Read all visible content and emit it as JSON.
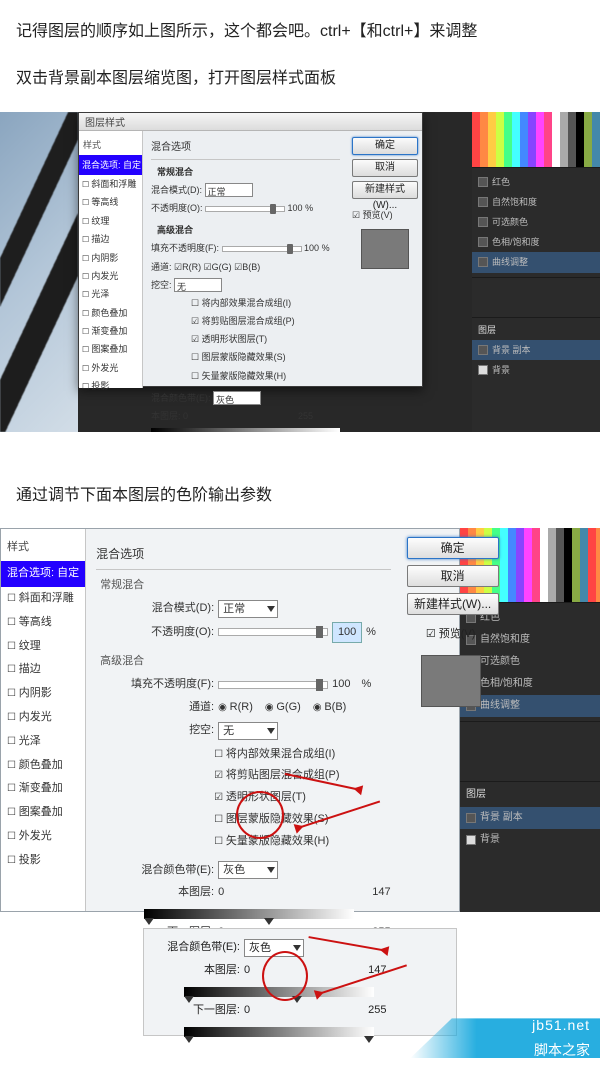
{
  "article": {
    "p1": "记得图层的顺序如上图所示，这个都会吧。ctrl+【和ctrl+】来调整",
    "p2": "双击背景副本图层缩览图，打开图层样式面板",
    "p3": "通过调节下面本图层的色阶输出参数"
  },
  "dialog": {
    "title": "图层样式",
    "styles_header": "样式",
    "selected": "混合选项: 自定",
    "items": [
      "斜面和浮雕",
      "等高线",
      "纹理",
      "描边",
      "内阴影",
      "内发光",
      "光泽",
      "颜色叠加",
      "渐变叠加",
      "图案叠加",
      "外发光",
      "投影"
    ],
    "section_blend": "混合选项",
    "section_general": "常规混合",
    "blend_mode_label": "混合模式(D):",
    "blend_mode_value": "正常",
    "opacity_label": "不透明度(O):",
    "opacity_value": "100",
    "pct": "%",
    "section_adv": "高级混合",
    "fill_label": "填充不透明度(F):",
    "fill_value": "100",
    "channel_label": "通道:",
    "ch_r": "R(R)",
    "ch_g": "G(G)",
    "ch_b": "B(B)",
    "knockout_label": "挖空:",
    "knockout_value": "无",
    "adv1": "将内部效果混合成组(I)",
    "adv2": "将剪贴图层混合成组(P)",
    "adv3": "透明形状图层(T)",
    "adv4": "图层蒙版隐藏效果(S)",
    "adv5": "矢量蒙版隐藏效果(H)",
    "blendif_label": "混合颜色带(E):",
    "blendif_value": "灰色",
    "this_layer": "本图层:",
    "under_layer": "下一图层:",
    "v0": "0",
    "v147": "147",
    "v255": "255",
    "btn_ok": "确定",
    "btn_cancel": "取消",
    "btn_newstyle": "新建样式(W)...",
    "preview": "预览(V)"
  },
  "panels": {
    "layers_tab": "图层",
    "row1": "背景 副本",
    "row2": "背景",
    "adj1": "红色",
    "adj2": "自然饱和度",
    "adj3": "可选颜色",
    "adj4": "色相/饱和度",
    "adj5": "曲线调整"
  },
  "watermark": {
    "url": "jb51.net",
    "name": "脚本之家"
  }
}
